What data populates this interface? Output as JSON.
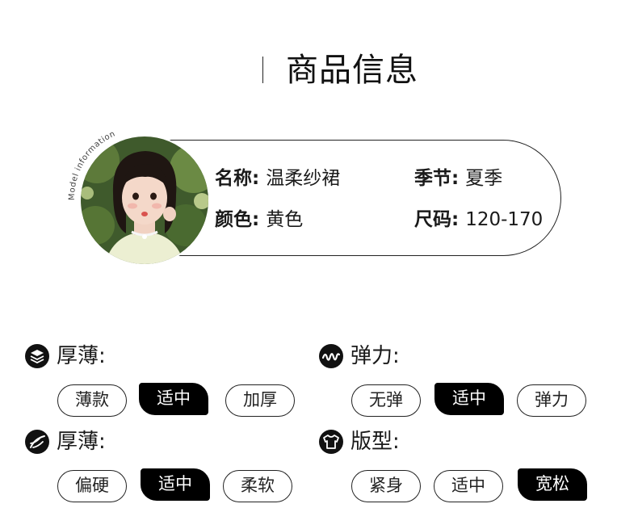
{
  "header": {
    "title": "商品信息"
  },
  "model_card": {
    "badge": "Model information",
    "fields": [
      {
        "key": "名称:",
        "value": "温柔纱裙"
      },
      {
        "key": "季节:",
        "value": "夏季"
      },
      {
        "key": "颜色:",
        "value": "黄色"
      },
      {
        "key": "尺码:",
        "value": "120-170"
      }
    ]
  },
  "attributes": [
    {
      "icon": "layers-icon",
      "label": "厚薄:",
      "options": [
        "薄款",
        "适中",
        "加厚"
      ],
      "selected": "适中"
    },
    {
      "icon": "wave-icon",
      "label": "弹力:",
      "options": [
        "无弹",
        "适中",
        "弹力"
      ],
      "selected": "适中"
    },
    {
      "icon": "feather-icon",
      "label": "厚薄:",
      "options": [
        "偏硬",
        "适中",
        "柔软"
      ],
      "selected": "适中"
    },
    {
      "icon": "tshirt-icon",
      "label": "版型:",
      "options": [
        "紧身",
        "适中",
        "宽松"
      ],
      "selected": "宽松"
    }
  ]
}
